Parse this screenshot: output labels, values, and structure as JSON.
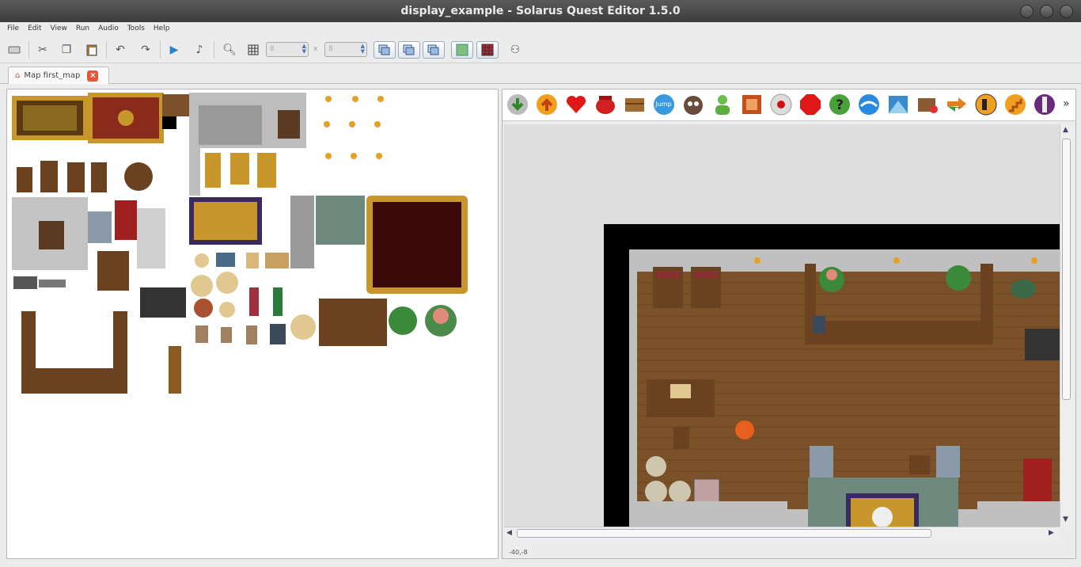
{
  "window": {
    "title": "display_example - Solarus Quest Editor 1.5.0"
  },
  "menubar": {
    "items": [
      "File",
      "Edit",
      "View",
      "Run",
      "Audio",
      "Tools",
      "Help"
    ]
  },
  "toolbar": {
    "grid_width": "8",
    "grid_height": "8",
    "grid_separator": "x"
  },
  "tabs": [
    {
      "label": "Map first_map"
    }
  ],
  "entity_toolbar": {
    "jump_label": "Jump",
    "more": "»"
  },
  "status": {
    "coords": "-40,-8"
  },
  "colors": {
    "title_bg": "#3c3c3c",
    "floor": "#7a5128",
    "wall": "#b8b8b8",
    "void": "#000000",
    "carpet": "#6b1420",
    "gold": "#c8962a"
  }
}
